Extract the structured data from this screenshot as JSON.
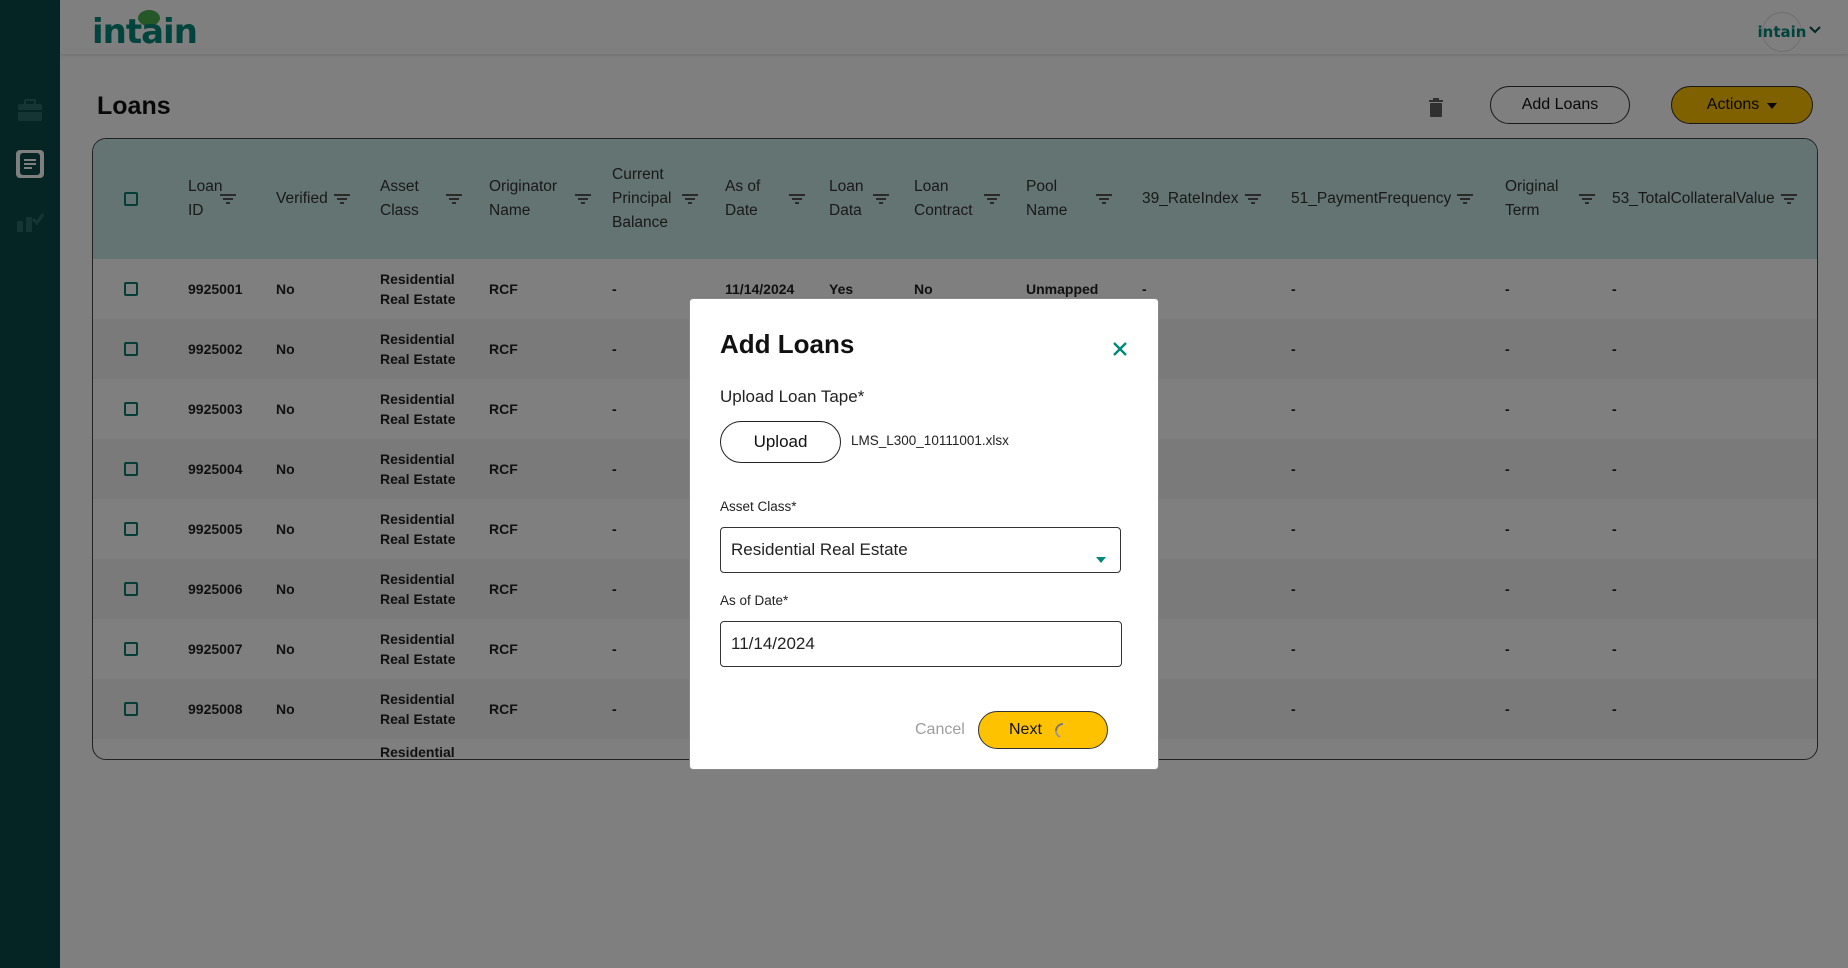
{
  "brand": {
    "logo_text": "intain",
    "avatar_text": "intain"
  },
  "sidebar": {
    "items": [
      {
        "icon": "briefcase-icon"
      },
      {
        "icon": "document-icon",
        "active": true
      },
      {
        "icon": "chart-check-icon"
      }
    ]
  },
  "page": {
    "title": "Loans",
    "add_loans_label": "Add Loans",
    "actions_label": "Actions"
  },
  "table": {
    "headers": {
      "loan_id": "Loan ID",
      "verified": "Verified",
      "asset_class": "Asset Class",
      "originator_name": "Originator Name",
      "current_principal_balance": "Current Principal Balance",
      "as_of_date": "As of Date",
      "loan_data": "Loan Data",
      "loan_contract": "Loan Contract",
      "pool_name": "Pool Name",
      "rate_index": "39_RateIndex",
      "payment_frequency": "51_PaymentFrequency",
      "original_term": "Original Term",
      "total_collateral_value": "53_TotalCollateralValue"
    },
    "rows": [
      {
        "loan_id": "9925001",
        "verified": "No",
        "asset_class": "Residential Real Estate",
        "originator": "RCF",
        "balance": "-",
        "as_of_date": "11/14/2024",
        "loan_data": "Yes",
        "loan_contract": "No",
        "pool_name": "Unmapped",
        "rate_index": "-",
        "payment_frequency": "-",
        "original_term": "-",
        "total_collateral_value": "-"
      },
      {
        "loan_id": "9925002",
        "verified": "No",
        "asset_class": "Residential Real Estate",
        "originator": "RCF",
        "balance": "-",
        "payment_frequency": "-",
        "original_term": "-",
        "total_collateral_value": "-"
      },
      {
        "loan_id": "9925003",
        "verified": "No",
        "asset_class": "Residential Real Estate",
        "originator": "RCF",
        "balance": "-",
        "payment_frequency": "-",
        "original_term": "-",
        "total_collateral_value": "-"
      },
      {
        "loan_id": "9925004",
        "verified": "No",
        "asset_class": "Residential Real Estate",
        "originator": "RCF",
        "balance": "-",
        "payment_frequency": "-",
        "original_term": "-",
        "total_collateral_value": "-"
      },
      {
        "loan_id": "9925005",
        "verified": "No",
        "asset_class": "Residential Real Estate",
        "originator": "RCF",
        "balance": "-",
        "payment_frequency": "-",
        "original_term": "-",
        "total_collateral_value": "-"
      },
      {
        "loan_id": "9925006",
        "verified": "No",
        "asset_class": "Residential Real Estate",
        "originator": "RCF",
        "balance": "-",
        "payment_frequency": "-",
        "original_term": "-",
        "total_collateral_value": "-"
      },
      {
        "loan_id": "9925007",
        "verified": "No",
        "asset_class": "Residential Real Estate",
        "originator": "RCF",
        "balance": "-",
        "payment_frequency": "-",
        "original_term": "-",
        "total_collateral_value": "-"
      },
      {
        "loan_id": "9925008",
        "verified": "No",
        "asset_class": "Residential Real Estate",
        "originator": "RCF",
        "balance": "-",
        "payment_frequency": "-",
        "original_term": "-",
        "total_collateral_value": "-"
      }
    ],
    "partial_row": {
      "asset_class": "Residential"
    }
  },
  "modal": {
    "title": "Add Loans",
    "upload_label": "Upload Loan Tape*",
    "upload_button": "Upload",
    "file_name": "LMS_L300_10111001.xlsx",
    "asset_class_label": "Asset Class*",
    "asset_class_value": "Residential Real Estate",
    "as_of_date_label": "As of Date*",
    "as_of_date_value": "11/14/2024",
    "cancel_label": "Cancel",
    "next_label": "Next"
  },
  "colors": {
    "sidebar": "#0b4a4a",
    "brand_teal": "#00897b",
    "accent_yellow": "#fec200",
    "table_header": "#c8e8e4"
  }
}
